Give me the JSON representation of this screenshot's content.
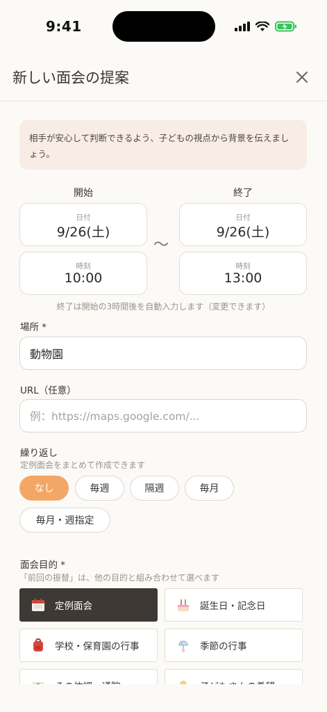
{
  "status": {
    "time": "9:41"
  },
  "header": {
    "title": "新しい面会の提案"
  },
  "notice": {
    "text": "相手が安心して判断できるよう、子どもの視点から背景を伝えましょう。"
  },
  "datetime": {
    "start": {
      "label": "開始",
      "date_caption": "日付",
      "date": "9/26(土)",
      "time_caption": "時刻",
      "time": "10:00"
    },
    "end": {
      "label": "終了",
      "date_caption": "日付",
      "date": "9/26(土)",
      "time_caption": "時刻",
      "time": "13:00"
    },
    "separator": "〜",
    "helper": "終了は開始の3時間後を自動入力します（変更できます）"
  },
  "location": {
    "label": "場所 *",
    "value": "動物園"
  },
  "url": {
    "label": "URL（任意）",
    "placeholder": "例：https://maps.google.com/..."
  },
  "repeat": {
    "label": "繰り返し",
    "sub": "定例面会をまとめて作成できます",
    "options": [
      "なし",
      "毎週",
      "隔週",
      "毎月",
      "毎月・週指定"
    ],
    "selected": "なし"
  },
  "purpose": {
    "label": "面会目的 *",
    "sub": "「前回の振替」は、他の目的と組み合わせて選べます",
    "options": [
      {
        "label": "定例面会",
        "icon": "calendar-icon",
        "selected": true
      },
      {
        "label": "誕生日・記念日",
        "icon": "cake-icon",
        "selected": false
      },
      {
        "label": "学校・保育園の行事",
        "icon": "backpack-icon",
        "selected": false
      },
      {
        "label": "季節の行事",
        "icon": "wind-chime-icon",
        "selected": false
      },
      {
        "label": "その体調・通院",
        "icon": "hospital-icon",
        "selected": false
      },
      {
        "label": "子どもさんの希望",
        "icon": "child-icon",
        "selected": false
      }
    ]
  },
  "colors": {
    "accent": "#f3a766",
    "selected_dark": "#3e3934",
    "notice_bg": "#f8ede6",
    "battery_green": "#34c759"
  }
}
